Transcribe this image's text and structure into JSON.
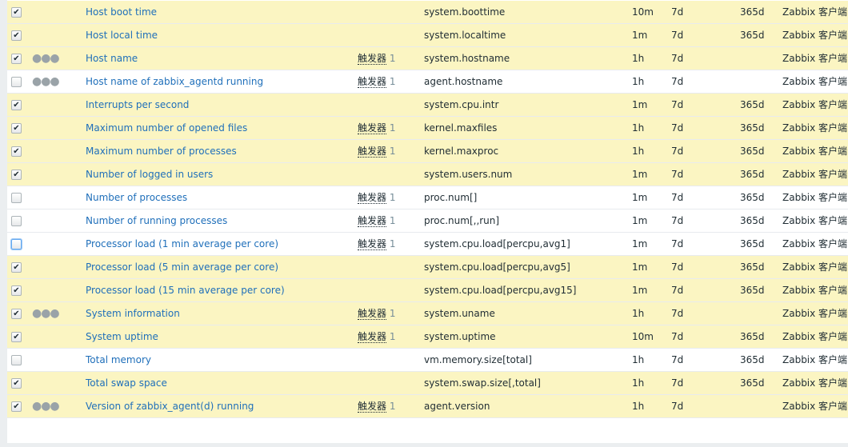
{
  "trigger_label": "触发器",
  "colors": {
    "selected_row": "#fbf5c2",
    "link": "#1f6fba"
  },
  "rows": [
    {
      "checked": true,
      "menu": false,
      "name": "Host boot time",
      "triggers": "",
      "key": "system.boottime",
      "interval": "10m",
      "history": "7d",
      "trends": "365d",
      "type": "Zabbix 客户端"
    },
    {
      "checked": true,
      "menu": false,
      "name": "Host local time",
      "triggers": "",
      "key": "system.localtime",
      "interval": "1m",
      "history": "7d",
      "trends": "365d",
      "type": "Zabbix 客户端"
    },
    {
      "checked": true,
      "menu": true,
      "name": "Host name",
      "triggers": "1",
      "key": "system.hostname",
      "interval": "1h",
      "history": "7d",
      "trends": "",
      "type": "Zabbix 客户端"
    },
    {
      "checked": false,
      "menu": true,
      "name": "Host name of zabbix_agentd running",
      "triggers": "1",
      "key": "agent.hostname",
      "interval": "1h",
      "history": "7d",
      "trends": "",
      "type": "Zabbix 客户端"
    },
    {
      "checked": true,
      "menu": false,
      "name": "Interrupts per second",
      "triggers": "",
      "key": "system.cpu.intr",
      "interval": "1m",
      "history": "7d",
      "trends": "365d",
      "type": "Zabbix 客户端"
    },
    {
      "checked": true,
      "menu": false,
      "name": "Maximum number of opened files",
      "triggers": "1",
      "key": "kernel.maxfiles",
      "interval": "1h",
      "history": "7d",
      "trends": "365d",
      "type": "Zabbix 客户端"
    },
    {
      "checked": true,
      "menu": false,
      "name": "Maximum number of processes",
      "triggers": "1",
      "key": "kernel.maxproc",
      "interval": "1h",
      "history": "7d",
      "trends": "365d",
      "type": "Zabbix 客户端"
    },
    {
      "checked": true,
      "menu": false,
      "name": "Number of logged in users",
      "triggers": "",
      "key": "system.users.num",
      "interval": "1m",
      "history": "7d",
      "trends": "365d",
      "type": "Zabbix 客户端"
    },
    {
      "checked": false,
      "menu": false,
      "name": "Number of processes",
      "triggers": "1",
      "key": "proc.num[]",
      "interval": "1m",
      "history": "7d",
      "trends": "365d",
      "type": "Zabbix 客户端"
    },
    {
      "checked": false,
      "menu": false,
      "name": "Number of running processes",
      "triggers": "1",
      "key": "proc.num[,,run]",
      "interval": "1m",
      "history": "7d",
      "trends": "365d",
      "type": "Zabbix 客户端"
    },
    {
      "checked": false,
      "focus": true,
      "menu": false,
      "name": "Processor load (1 min average per core)",
      "triggers": "1",
      "key": "system.cpu.load[percpu,avg1]",
      "interval": "1m",
      "history": "7d",
      "trends": "365d",
      "type": "Zabbix 客户端"
    },
    {
      "checked": true,
      "menu": false,
      "name": "Processor load (5 min average per core)",
      "triggers": "",
      "key": "system.cpu.load[percpu,avg5]",
      "interval": "1m",
      "history": "7d",
      "trends": "365d",
      "type": "Zabbix 客户端"
    },
    {
      "checked": true,
      "menu": false,
      "name": "Processor load (15 min average per core)",
      "triggers": "",
      "key": "system.cpu.load[percpu,avg15]",
      "interval": "1m",
      "history": "7d",
      "trends": "365d",
      "type": "Zabbix 客户端"
    },
    {
      "checked": true,
      "menu": true,
      "name": "System information",
      "triggers": "1",
      "key": "system.uname",
      "interval": "1h",
      "history": "7d",
      "trends": "",
      "type": "Zabbix 客户端"
    },
    {
      "checked": true,
      "menu": false,
      "name": "System uptime",
      "triggers": "1",
      "key": "system.uptime",
      "interval": "10m",
      "history": "7d",
      "trends": "365d",
      "type": "Zabbix 客户端"
    },
    {
      "checked": false,
      "menu": false,
      "name": "Total memory",
      "triggers": "",
      "key": "vm.memory.size[total]",
      "interval": "1h",
      "history": "7d",
      "trends": "365d",
      "type": "Zabbix 客户端"
    },
    {
      "checked": true,
      "menu": false,
      "name": "Total swap space",
      "triggers": "",
      "key": "system.swap.size[,total]",
      "interval": "1h",
      "history": "7d",
      "trends": "365d",
      "type": "Zabbix 客户端"
    },
    {
      "checked": true,
      "menu": true,
      "name": "Version of zabbix_agent(d) running",
      "triggers": "1",
      "key": "agent.version",
      "interval": "1h",
      "history": "7d",
      "trends": "",
      "type": "Zabbix 客户端"
    }
  ]
}
